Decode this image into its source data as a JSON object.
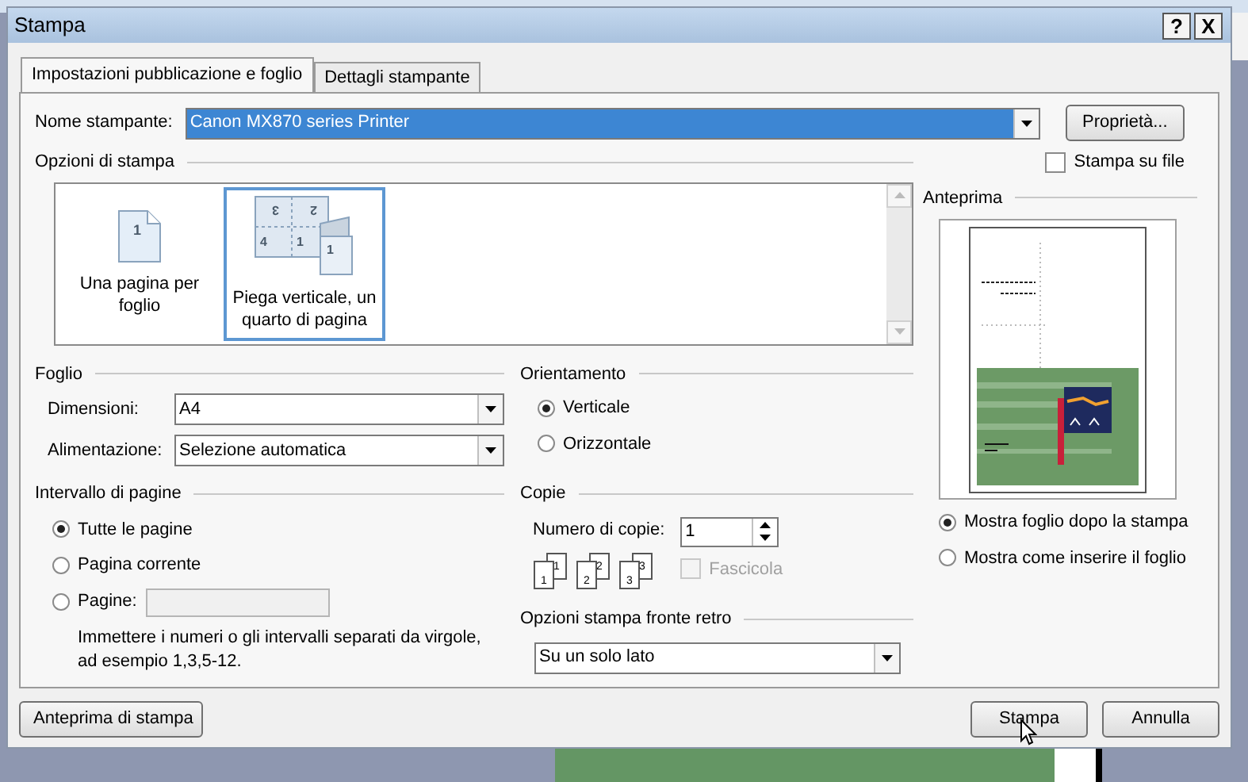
{
  "window": {
    "title": "Stampa",
    "help_button": "?",
    "close_button": "X"
  },
  "tabs": [
    {
      "label": "Impostazioni pubblicazione e foglio",
      "selected": true
    },
    {
      "label": "Dettagli stampante",
      "selected": false
    }
  ],
  "printer": {
    "label": "Nome stampante:",
    "value": "Canon MX870 series Printer",
    "properties_button": "Proprietà...",
    "print_to_file": {
      "label": "Stampa su file",
      "checked": false
    }
  },
  "print_options": {
    "title": "Opzioni di stampa",
    "items": [
      {
        "kind": "single",
        "label": "Una pagina per foglio",
        "page_numbers": [
          "1"
        ],
        "selected": false
      },
      {
        "kind": "booklet",
        "label": "Piega verticale, un quarto di pagina",
        "page_numbers": [
          "3",
          "2",
          "4",
          "1",
          "1"
        ],
        "selected": true
      }
    ]
  },
  "sheet": {
    "title": "Foglio",
    "fields": [
      {
        "label": "Dimensioni:",
        "value": "A4"
      },
      {
        "label": "Alimentazione:",
        "value": "Selezione automatica"
      }
    ]
  },
  "orientation": {
    "title": "Orientamento",
    "options": [
      {
        "label": "Verticale",
        "selected": true
      },
      {
        "label": "Orizzontale",
        "selected": false
      }
    ]
  },
  "page_range": {
    "title": "Intervallo di pagine",
    "options": [
      {
        "kind": "plain",
        "label": "Tutte le pagine",
        "selected": true
      },
      {
        "kind": "plain",
        "label": "Pagina corrente",
        "selected": false
      },
      {
        "kind": "input",
        "label": "Pagine:",
        "selected": false
      }
    ],
    "hint": "Immettere i numeri o gli intervalli separati da virgole, ad esempio 1,3,5-12."
  },
  "copies": {
    "title": "Copie",
    "label": "Numero di copie:",
    "value": "1",
    "pages": [
      "1",
      "1",
      "2",
      "2",
      "3",
      "3"
    ],
    "collate": {
      "label": "Fascicola",
      "checked": false,
      "disabled": true
    }
  },
  "duplex": {
    "title": "Opzioni stampa fronte retro",
    "value": "Su un solo lato"
  },
  "preview": {
    "title": "Anteprima",
    "options": [
      {
        "label": "Mostra foglio dopo la stampa",
        "selected": true
      },
      {
        "label": "Mostra come inserire il foglio",
        "selected": false
      }
    ]
  },
  "buttons": {
    "print_preview": "Anteprima di stampa",
    "print": "Stampa",
    "cancel": "Annulla"
  }
}
